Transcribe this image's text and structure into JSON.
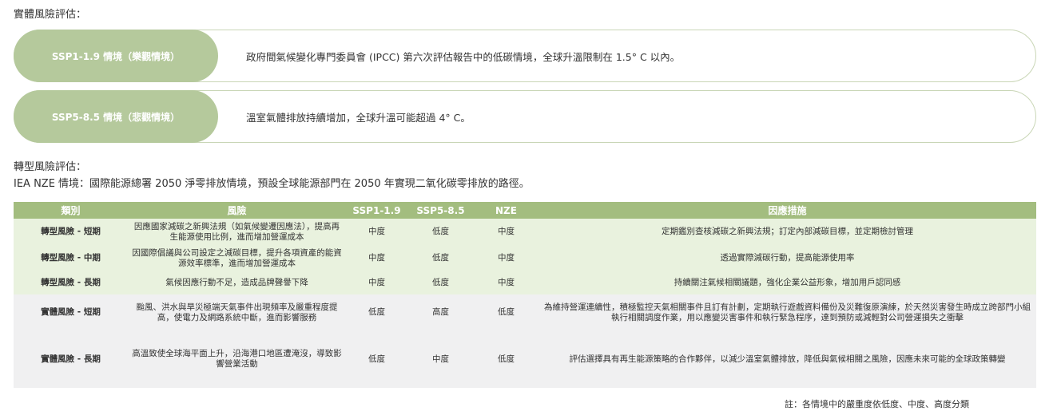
{
  "physical_risk": {
    "heading": "實體風險評估：",
    "scenarios": [
      {
        "label": "SSP1-1.9 情境（樂觀情境）",
        "description": "政府間氣候變化專門委員會 (IPCC) 第六次評估報告中的低碳情境，全球升溫限制在 1.5° C 以內。"
      },
      {
        "label": "SSP5-8.5 情境（悲觀情境）",
        "description": "溫室氣體排放持續增加，全球升溫可能超過 4° C。"
      }
    ]
  },
  "transition_risk": {
    "heading": "轉型風險評估：",
    "nze_description": "IEA NZE 情境：國際能源總署 2050 淨零排放情境，預設全球能源部門在 2050 年實現二氧化碳零排放的路徑。"
  },
  "risk_table": {
    "headers": [
      "類別",
      "風險",
      "SSP1-1.9",
      "SSP5-8.5",
      "NZE",
      "因應措施"
    ],
    "rows": [
      {
        "category": "轉型風險 - 短期",
        "risk": "因應國家減碳之新興法規（如氣候變遷因應法），提高再生能源使用比例，進而增加營運成本",
        "ssp119": "中度",
        "ssp585": "低度",
        "nze": "中度",
        "measure": "定期鑑別查核減碳之新興法規；訂定內部減碳目標，並定期檢討管理"
      },
      {
        "category": "轉型風險 - 中期",
        "risk": "因國際倡議與公司設定之減碳目標，提升各項資產的能資源效率標準，進而增加營運成本",
        "ssp119": "中度",
        "ssp585": "低度",
        "nze": "中度",
        "measure": "透過實際減碳行動，提高能源使用率"
      },
      {
        "category": "轉型風險 - 長期",
        "risk": "氣候因應行動不足，造成品牌聲譽下降",
        "ssp119": "中度",
        "ssp585": "低度",
        "nze": "中度",
        "measure": "持續關注氣候相關議題，強化企業公益形象，增加用戶認同感"
      },
      {
        "category": "實體風險 - 短期",
        "risk": "颱風、洪水與旱災極端天氣事件出現頻率及嚴重程度提高，使電力及網路系統中斷，進而影響服務",
        "ssp119": "低度",
        "ssp585": "高度",
        "nze": "低度",
        "measure": "為維持營運連續性，積極監控天氣相關事件且訂有計劃，定期執行遊戲資料備份及災難復原演練，於天然災害發生時成立跨部門小組執行相關調度作業，用以應變災害事件和執行緊急程序，達到預防或減輕對公司營運損失之衝擊"
      },
      {
        "category": "實體風險 - 長期",
        "risk": "高溫致使全球海平面上升，沿海港口地區遭淹沒，導致影響營業活動",
        "ssp119": "低度",
        "ssp585": "中度",
        "nze": "低度",
        "measure": "評估選擇具有再生能源策略的合作夥伴，以減少溫室氣體排放，降低與氣候相關之風險，因應未來可能的全球政策轉變"
      }
    ]
  },
  "note": "註：各情境中的嚴重度依低度、中度、高度分類",
  "colors": {
    "pill": "#b5c99c",
    "header": "#a3bd7f",
    "transition_row": "#e9f2de",
    "physical_row": "#f0f0f1"
  }
}
